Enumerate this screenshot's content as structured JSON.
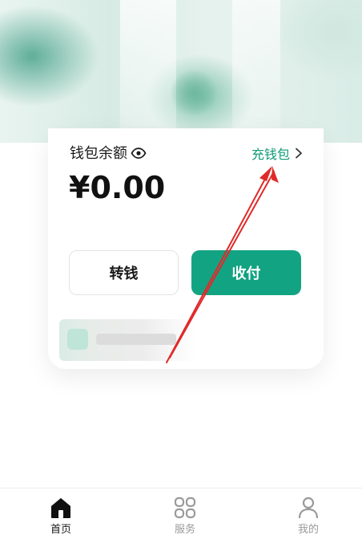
{
  "wallet": {
    "balance_label": "钱包余额",
    "balance_amount": "¥0.00",
    "recharge_label": "充钱包",
    "transfer_label": "转钱",
    "receive_label": "收付"
  },
  "tabbar": {
    "items": [
      {
        "label": "首页",
        "icon": "home-icon",
        "active": true
      },
      {
        "label": "服务",
        "icon": "services-grid-icon",
        "active": false
      },
      {
        "label": "我的",
        "icon": "user-icon",
        "active": false
      }
    ]
  },
  "colors": {
    "accent": "#12a382",
    "link": "#0f9a78",
    "annotation": "#e02a2a"
  }
}
